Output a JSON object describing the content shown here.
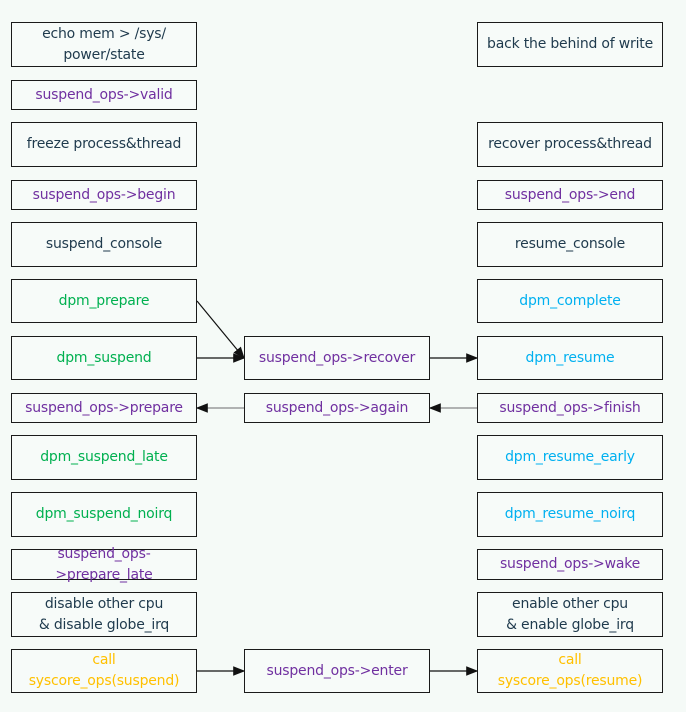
{
  "colors": {
    "dark": "#1f3a4d",
    "purple": "#7030a0",
    "green": "#00b050",
    "blue": "#00b0f0",
    "orange": "#ffc000"
  },
  "boxes": {
    "echo_mem": {
      "text": "echo mem > /sys/\npower/state",
      "color": "dark"
    },
    "valid": {
      "text": "suspend_ops->valid",
      "color": "purple"
    },
    "freeze": {
      "text": "freeze process&thread",
      "color": "dark"
    },
    "begin": {
      "text": "suspend_ops->begin",
      "color": "purple"
    },
    "suspend_console": {
      "text": "suspend_console",
      "color": "dark"
    },
    "dpm_prepare": {
      "text": "dpm_prepare",
      "color": "green"
    },
    "dpm_suspend": {
      "text": "dpm_suspend",
      "color": "green"
    },
    "prepare": {
      "text": "suspend_ops->prepare",
      "color": "purple"
    },
    "dpm_suspend_late": {
      "text": "dpm_suspend_late",
      "color": "green"
    },
    "dpm_suspend_noirq": {
      "text": "dpm_suspend_noirq",
      "color": "green"
    },
    "prepare_late": {
      "text": "suspend_ops-\n>prepare_late",
      "color": "purple"
    },
    "disable_cpu": {
      "text": "disable other cpu\n& disable globe_irq",
      "color": "dark"
    },
    "syscore_suspend": {
      "text": "call\nsyscore_ops(suspend)",
      "color": "orange"
    },
    "recover": {
      "text": "suspend_ops->recover",
      "color": "purple"
    },
    "again": {
      "text": "suspend_ops->again",
      "color": "purple"
    },
    "enter": {
      "text": "suspend_ops->enter",
      "color": "purple"
    },
    "write_back": {
      "text": "back the behind of write",
      "color": "dark"
    },
    "recover_thread": {
      "text": "recover process&thread",
      "color": "dark"
    },
    "end": {
      "text": "suspend_ops->end",
      "color": "purple"
    },
    "resume_console": {
      "text": "resume_console",
      "color": "dark"
    },
    "dpm_complete": {
      "text": "dpm_complete",
      "color": "blue"
    },
    "dpm_resume": {
      "text": "dpm_resume",
      "color": "blue"
    },
    "finish": {
      "text": "suspend_ops->finish",
      "color": "purple"
    },
    "dpm_resume_early": {
      "text": "dpm_resume_early",
      "color": "blue"
    },
    "dpm_resume_noirq": {
      "text": "dpm_resume_noirq",
      "color": "blue"
    },
    "wake": {
      "text": "suspend_ops->wake",
      "color": "purple"
    },
    "enable_cpu": {
      "text": "enable other cpu\n& enable globe_irq",
      "color": "dark"
    },
    "syscore_resume": {
      "text": "call\nsyscore_ops(resume)",
      "color": "orange"
    }
  },
  "arrows": [
    {
      "from": "dpm_prepare",
      "to": "recover"
    },
    {
      "from": "dpm_suspend",
      "to": "recover"
    },
    {
      "from": "recover",
      "to": "dpm_resume"
    },
    {
      "from": "finish",
      "to": "again"
    },
    {
      "from": "again",
      "to": "prepare"
    },
    {
      "from": "syscore_suspend",
      "to": "enter"
    },
    {
      "from": "enter",
      "to": "syscore_resume"
    }
  ]
}
